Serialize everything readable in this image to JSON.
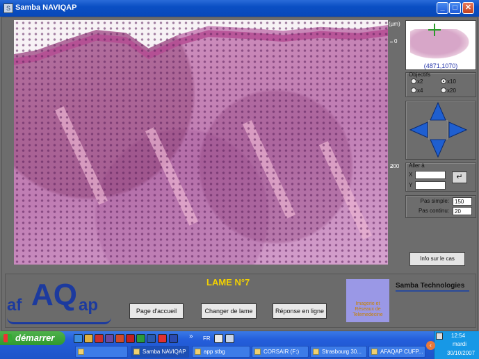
{
  "window": {
    "title": "Samba NAVIQAP",
    "minimize": "_",
    "maximize": "□",
    "close": "✕"
  },
  "viewer": {
    "scale_unit": "(µm)",
    "scale_ticks": [
      "0",
      "200"
    ]
  },
  "navigator": {
    "coords": "(4871,1070)"
  },
  "objectives": {
    "title": "Objectifs",
    "options": [
      "x2",
      "x10",
      "x4",
      "x20"
    ],
    "selected": "x10"
  },
  "goto": {
    "title": "Aller à",
    "x_label": "X",
    "y_label": "Y",
    "x_value": "",
    "y_value": "",
    "enter_glyph": "↵"
  },
  "steps": {
    "simple_label": "Pas simple:",
    "simple_value": "150",
    "continuous_label": "Pas continu:",
    "continuous_value": "20"
  },
  "info_button": "Info sur le cas",
  "lame": "LAME N°7",
  "logo": {
    "af": "af",
    "aq": "AQ",
    "ap": "ap"
  },
  "buttons": {
    "home": "Page d'accueil",
    "change": "Changer de lame",
    "answer": "Réponse en ligne"
  },
  "irt": "Imagerie et Réseaux de Telemedecine",
  "brand": "Samba Technologies",
  "taskbar": {
    "start": "démarrer",
    "lang": "FR",
    "quicklaunch_more": "»",
    "tasks": [
      "Samba NAVIQAP",
      "app stbg",
      "CORSAIR (F:)",
      "Strasbourg 30...",
      "AFAQAP CUFP..."
    ],
    "clock": "12:54",
    "day": "mardi",
    "date": "30/10/2007"
  },
  "colors": {
    "accent": "#245edb",
    "lame": "#f2d100",
    "brand_blue": "#1c3a9e",
    "nav_arrow": "#1f5fd0"
  }
}
